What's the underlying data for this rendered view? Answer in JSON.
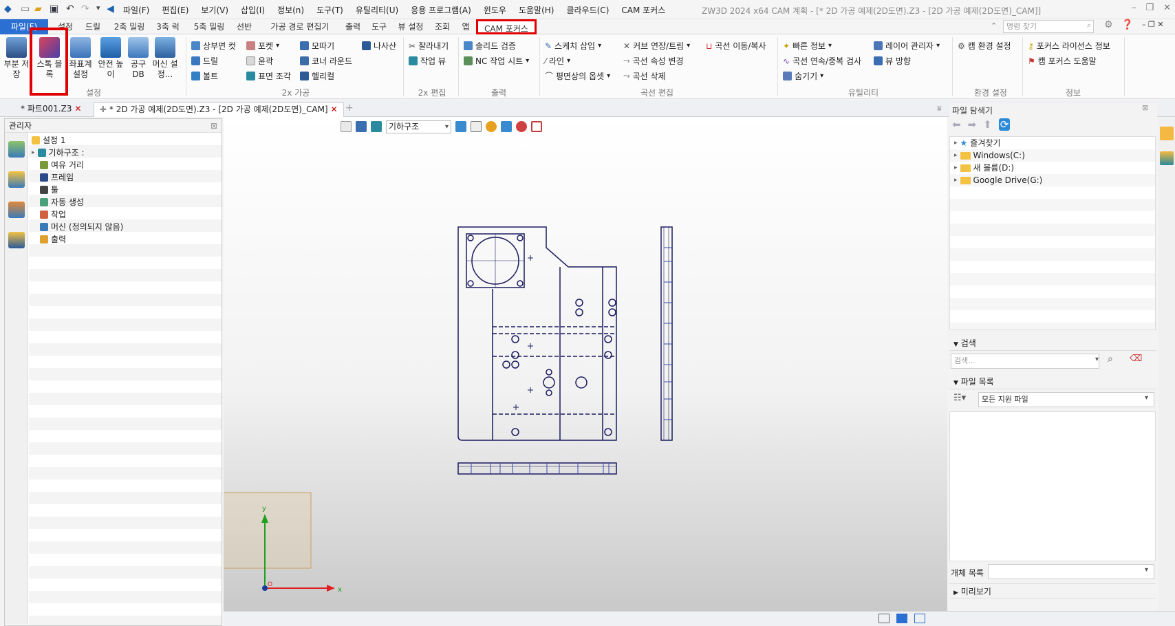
{
  "titlebar": {
    "menu": [
      "파일(F)",
      "편집(E)",
      "보기(V)",
      "삽입(I)",
      "정보(n)",
      "도구(T)",
      "유틸리티(U)",
      "응용 프로그램(A)",
      "윈도우",
      "도움말(H)",
      "클라우드(C)",
      "CAM 포커스"
    ],
    "title": "ZW3D 2024 x64        CAM 계획 - [* 2D 가공 예제(2D도면).Z3 - [2D 가공 예제(2D도면)_CAM]]"
  },
  "ribbon_tabs": [
    "파일(F)",
    "설정",
    "드릴",
    "2축 밀링",
    "3축 럭",
    "5축 밀링",
    "선반",
    "가공 경로 편집기",
    "출력",
    "도구",
    "뷰 설정",
    "조회",
    "앱",
    "CAM 포커스"
  ],
  "command_search": {
    "placeholder": "명령 찾기"
  },
  "ribbon": {
    "setup": {
      "label": "설정",
      "buttons": [
        "부분 저장",
        "스톡 블록",
        "좌표계 설정",
        "안전 높이",
        "공구 DB",
        "머신 설정..."
      ]
    },
    "machining2x": {
      "label": "2x 가공",
      "items": [
        "상부면 컷",
        "포켓",
        "모따기",
        "나사산",
        "드릴",
        "윤곽",
        "코너 라운드",
        "볼트",
        "표면 조각",
        "헬리컬"
      ]
    },
    "edit2x": {
      "label": "2x 편집",
      "items": [
        "잘라내기",
        "작업 뷰"
      ]
    },
    "output": {
      "label": "출력",
      "items": [
        "솔리드 검증",
        "NC 작업 시트"
      ]
    },
    "curve_edit": {
      "label": "곡선 편집",
      "items": [
        "스케치 삽입",
        "커브 연장/트림",
        "곡선 이동/복사",
        "라인",
        "곡선 속성 변경",
        "평면상의 옵셋",
        "곡선 삭제"
      ]
    },
    "utility": {
      "label": "유틸리티",
      "items": [
        "빠른 정보",
        "레이어 관리자",
        "곡선 연속/중복 검사",
        "뷰 방향",
        "숨기기"
      ]
    },
    "env": {
      "label": "환경 설정",
      "items": [
        "캠 환경 설정"
      ]
    },
    "info": {
      "label": "정보",
      "items": [
        "포커스 라이선스 정보",
        "캠 포커스 도움말"
      ]
    }
  },
  "doc_tabs": [
    "* 파트001.Z3",
    "* 2D 가공 예제(2D도면).Z3 - [2D 가공 예제(2D도면)_CAM]"
  ],
  "manager": {
    "title": "관리자",
    "tree": [
      "설정 1",
      "기하구조 :",
      "여유 거리",
      "프레임",
      "툴",
      "자동 생성",
      "작업",
      "머신 (정의되지 않음)",
      "출력"
    ]
  },
  "viewport": {
    "select_value": "기하구조",
    "axis_x": "x",
    "axis_y": "y",
    "origin": "O"
  },
  "explorer": {
    "title": "파일 탐색기",
    "tree": [
      "즐겨찾기",
      "Windows(C:)",
      "새 볼륨(D:)",
      "Google Drive(G:)"
    ],
    "search_head": "검색",
    "search_placeholder": "검색...",
    "filelist_head": "파일 목록",
    "filter": "모든 지원 파일",
    "object_list": "개체 목록",
    "preview": "미리보기"
  },
  "colors": {
    "accent": "#2a6fd1",
    "highlight": "#e00000",
    "drawing": "#1a1a5e"
  }
}
